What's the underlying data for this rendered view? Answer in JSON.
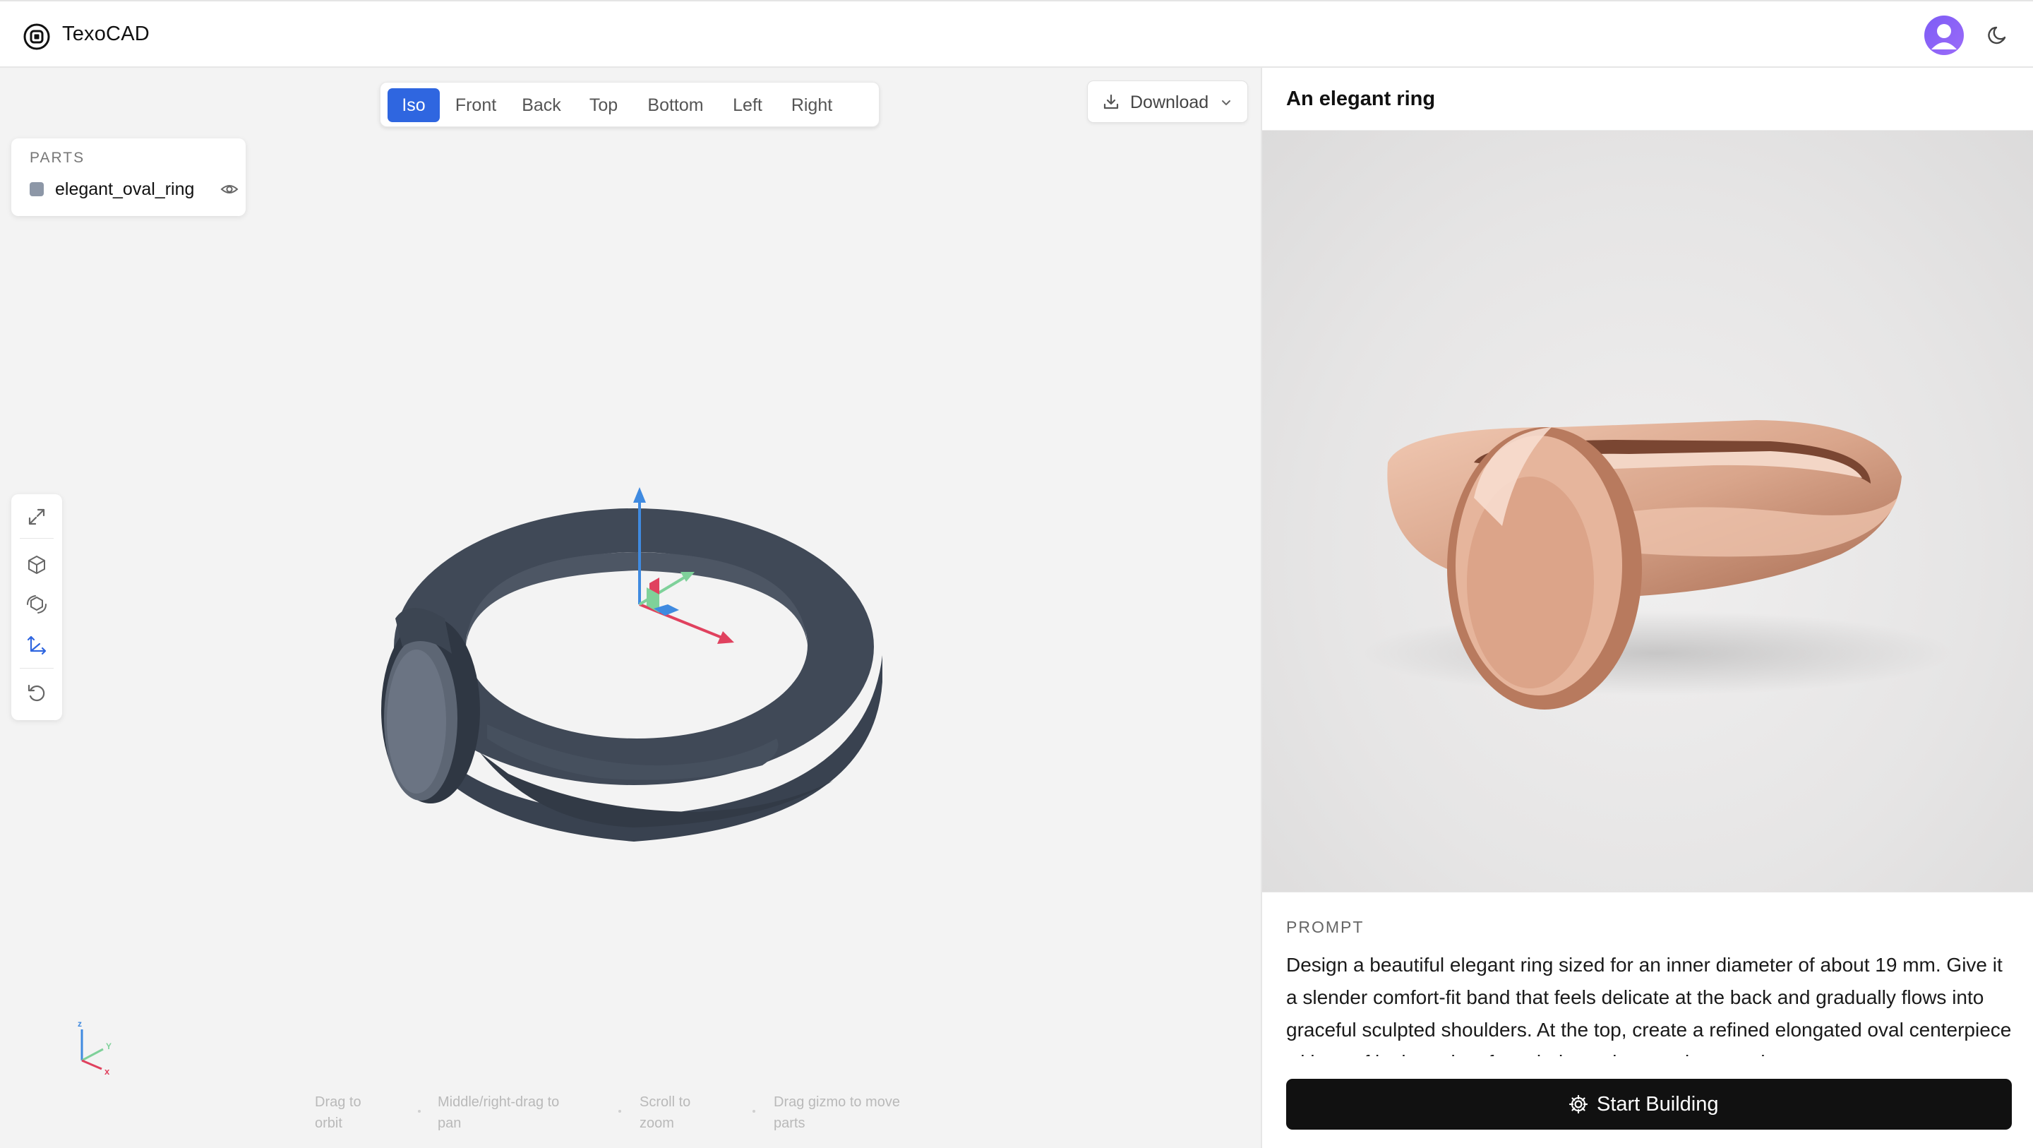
{
  "app": {
    "title": "TexoCAD"
  },
  "header": {
    "avatar_icon": "user-avatar-icon",
    "theme_icon": "moon-icon"
  },
  "viewer": {
    "view_tabs": [
      {
        "label": "Iso",
        "active": true
      },
      {
        "label": "Front",
        "active": false
      },
      {
        "label": "Back",
        "active": false
      },
      {
        "label": "Top",
        "active": false
      },
      {
        "label": "Bottom",
        "active": false
      },
      {
        "label": "Left",
        "active": false
      },
      {
        "label": "Right",
        "active": false
      }
    ],
    "download": {
      "label": "Download"
    },
    "parts": {
      "title": "PARTS",
      "items": [
        {
          "name": "elegant_oval_ring",
          "color": "#8d97a7"
        }
      ]
    },
    "tools": [
      "expand-icon",
      "cube-icon",
      "orbit-icon",
      "axes-icon",
      "reset-icon"
    ],
    "model_color": "#3f4856",
    "axes_mini": {
      "z": "z",
      "y": "Y",
      "x": "x"
    },
    "hints": [
      {
        "line1": "Drag to",
        "line2": "orbit"
      },
      {
        "line1": "Middle/right-drag to",
        "line2": "pan"
      },
      {
        "line1": "Scroll to",
        "line2": "zoom"
      },
      {
        "line1": "Drag gizmo to move",
        "line2": "parts"
      }
    ]
  },
  "panel": {
    "title": "An elegant ring",
    "prompt_label": "PROMPT",
    "prompt_text": "Design a beautiful elegant ring sized for an inner diameter of about 19 mm. Give it a slender comfort-fit band that feels delicate at the back and gradually flows into graceful sculpted shoulders. At the top, create a refined elongated oval centerpiece with a softly domed surface, balanced proportions, and",
    "start_button": "Start Building",
    "photo_color": "#d9a58b"
  }
}
